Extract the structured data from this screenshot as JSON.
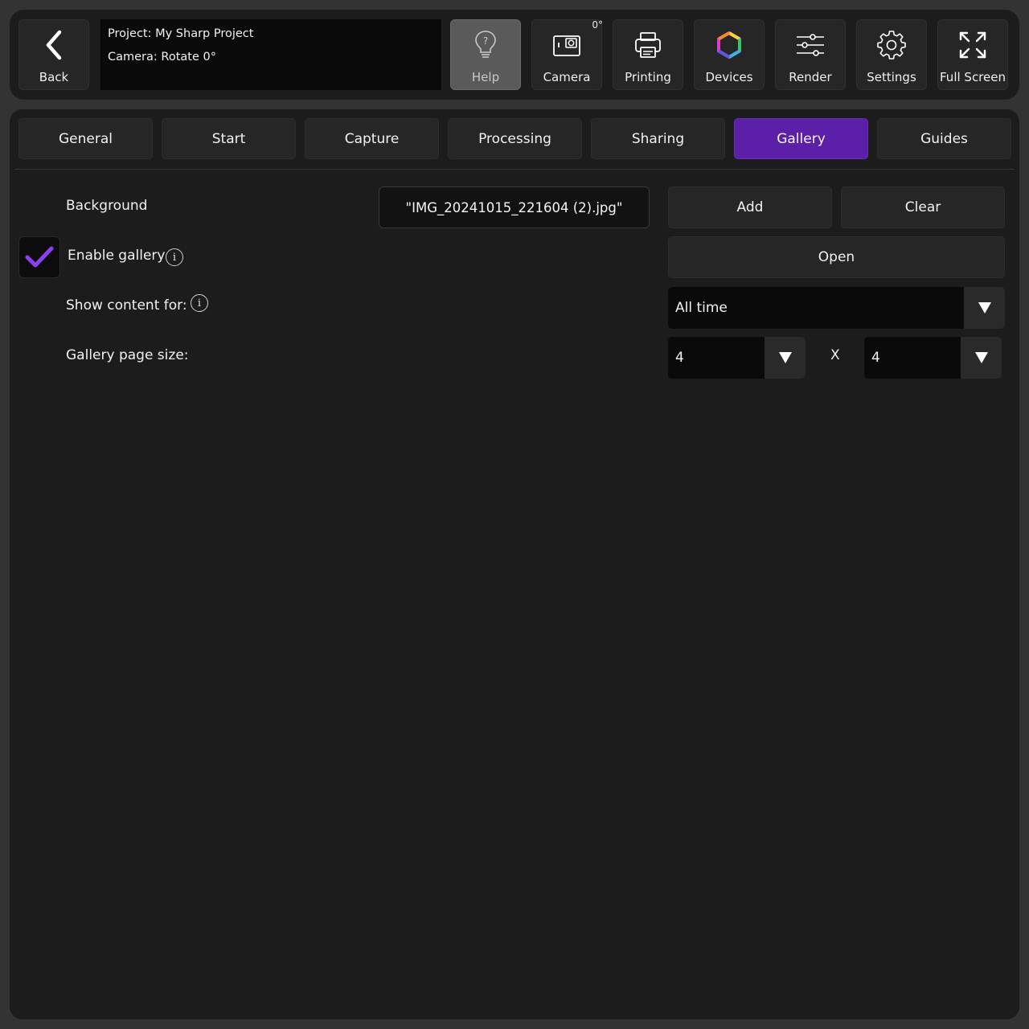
{
  "header": {
    "back_label": "Back",
    "project_line": "Project: My Sharp Project",
    "camera_line": "Camera: Rotate 0°",
    "rotation_badge": "0°",
    "buttons": {
      "help": "Help",
      "camera": "Camera",
      "printing": "Printing",
      "devices": "Devices",
      "render": "Render",
      "settings": "Settings",
      "fullscreen": "Full Screen"
    }
  },
  "tabs": [
    "General",
    "Start",
    "Capture",
    "Processing",
    "Sharing",
    "Gallery",
    "Guides"
  ],
  "active_tab": "Gallery",
  "gallery": {
    "background_label": "Background",
    "background_file": "\"IMG_20241015_221604 (2).jpg\"",
    "add_label": "Add",
    "clear_label": "Clear",
    "enable_label": "Enable gallery",
    "enabled": true,
    "open_label": "Open",
    "show_content_label": "Show content for:",
    "show_content_value": "All time",
    "page_size_label": "Gallery page size:",
    "page_size_cols": "4",
    "page_size_sep": "X",
    "page_size_rows": "4"
  },
  "colors": {
    "accent": "#5b1fa8",
    "check": "#8a3ff0"
  }
}
